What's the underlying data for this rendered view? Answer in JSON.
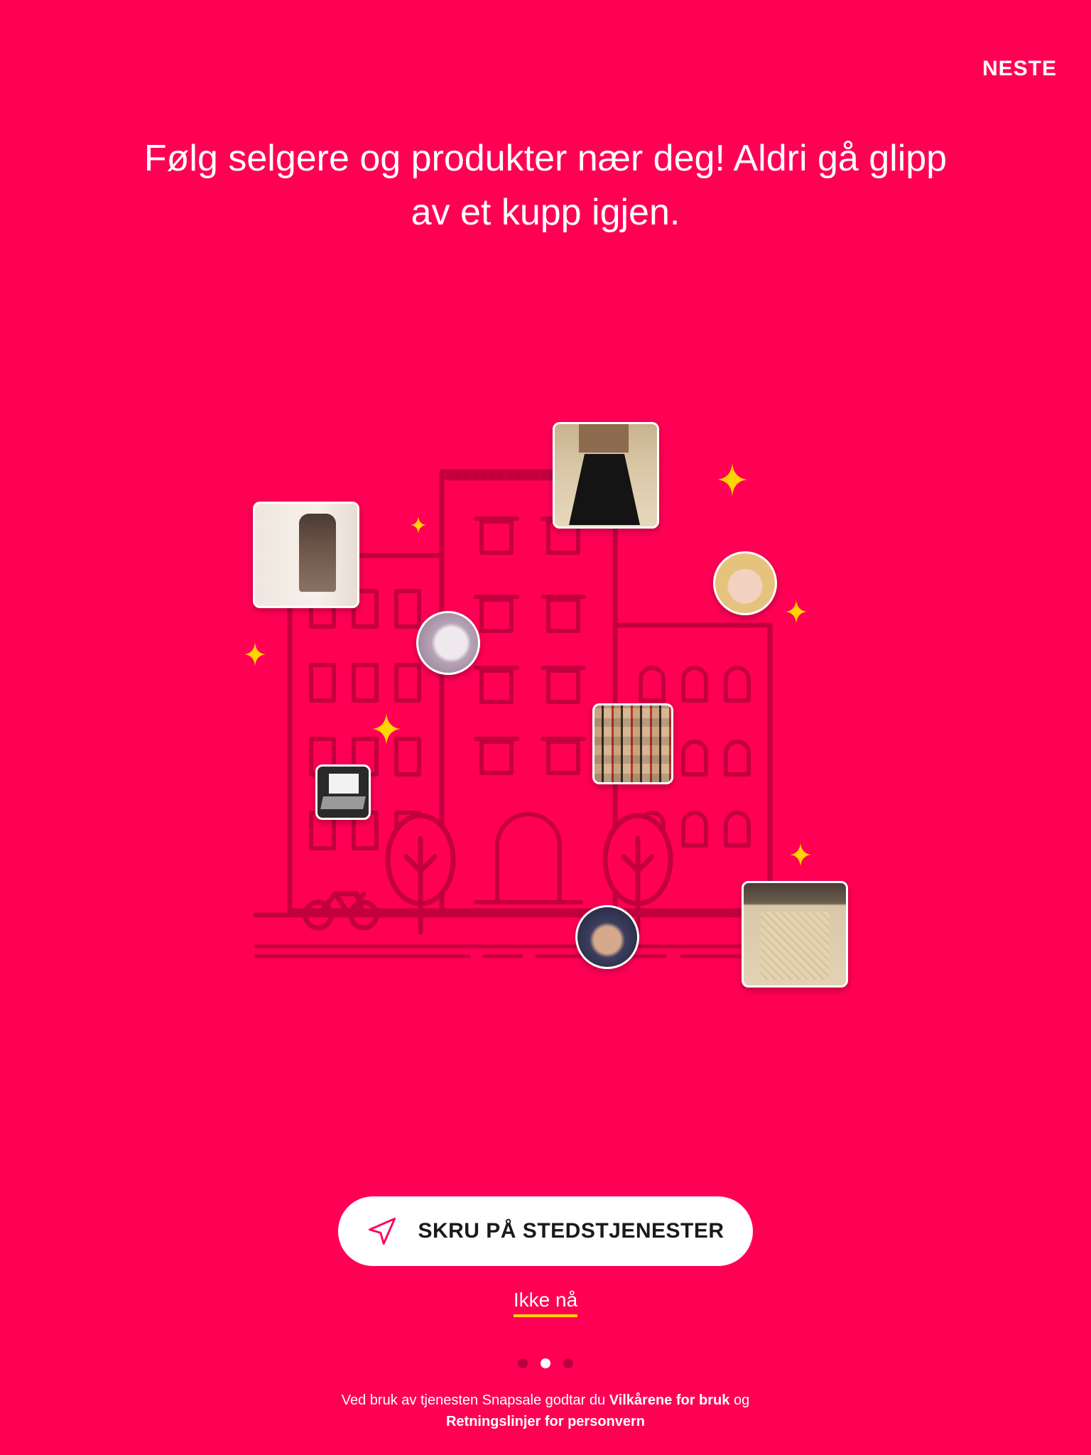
{
  "header": {
    "next_label": "NESTE"
  },
  "headline": "Følg selgere og produkter nær deg! Aldri gå glipp av et kupp igjen.",
  "illustration": {
    "photos": [
      {
        "name": "backpack-photo"
      },
      {
        "name": "skirt-photo"
      },
      {
        "name": "seller-avatar-smile"
      },
      {
        "name": "seller-avatar-blonde"
      },
      {
        "name": "scarf-photo"
      },
      {
        "name": "laptop-photo"
      },
      {
        "name": "handbag-photo"
      },
      {
        "name": "seller-avatar-sunglasses"
      }
    ]
  },
  "cta": {
    "label": "SKRU PÅ STEDSTJENESTER",
    "icon": "location-arrow-icon"
  },
  "secondary": {
    "not_now_label": "Ikke nå"
  },
  "pagination": {
    "current": 2,
    "total": 3
  },
  "terms": {
    "prefix": "Ved bruk av tjenesten Snapsale godtar du ",
    "terms_link": "Vilkårene for bruk",
    "joiner": " og ",
    "privacy_link": "Retningslinjer for personvern"
  },
  "colors": {
    "background": "#ff0055",
    "accent": "#ffd400",
    "line_art": "#c2003f"
  }
}
